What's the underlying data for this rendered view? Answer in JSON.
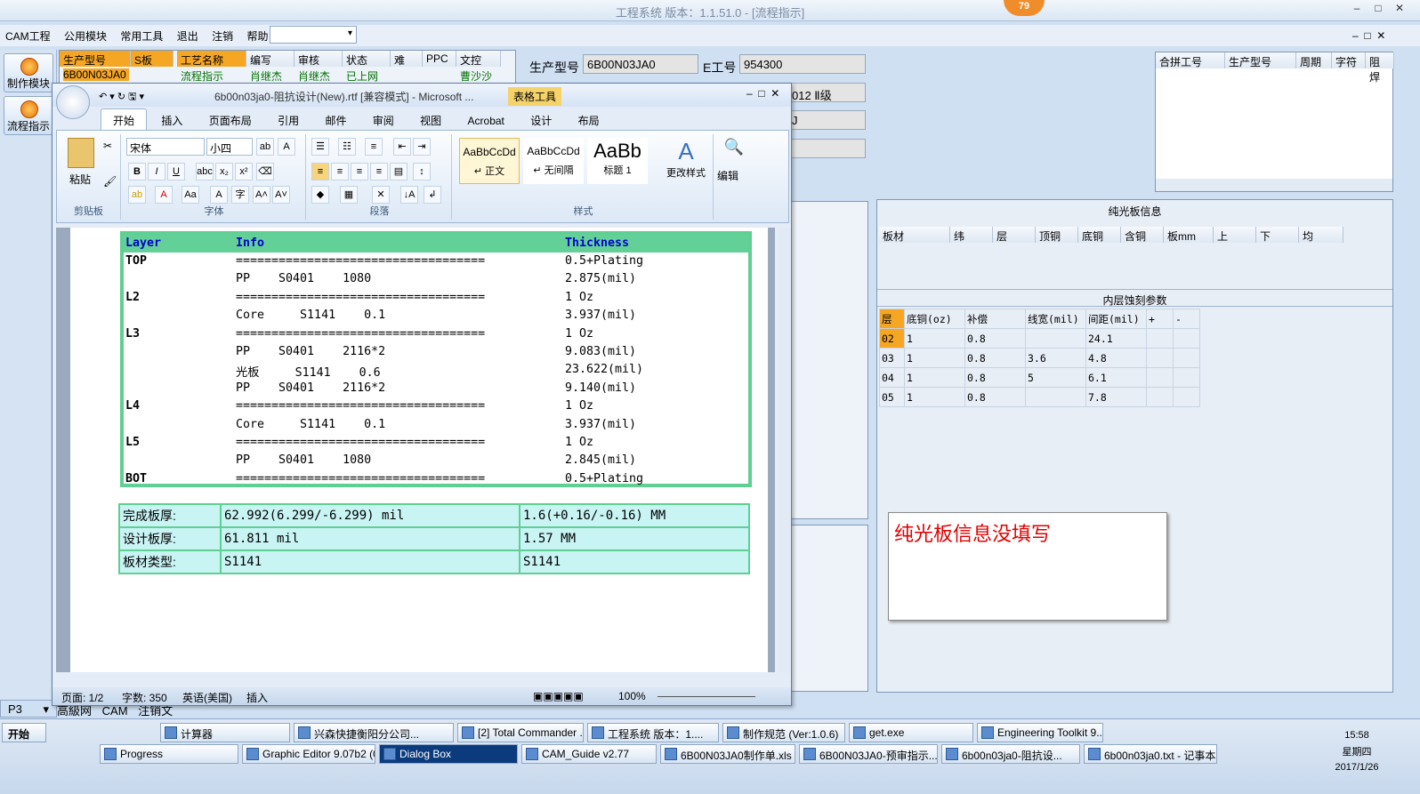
{
  "app": {
    "title": "工程系统  版本：1.1.51.0 - [流程指示]",
    "badge": "79"
  },
  "menu": [
    "CAM工程",
    "公用模块",
    "常用工具",
    "退出",
    "注销",
    "帮助"
  ],
  "left": {
    "btn1": "制作模块",
    "btn2": "流程指示",
    "page": "P3"
  },
  "topgrid": {
    "h1": "生产型号",
    "h2": "S板",
    "r1": "6B00N03JA0",
    "cols": [
      "工艺名称",
      "编写",
      "审核",
      "状态",
      "难",
      "PPC",
      "文控"
    ],
    "row": [
      "流程指示",
      "肖继杰",
      "肖继杰",
      "已上网",
      "",
      "",
      "曹沙沙"
    ]
  },
  "form": {
    "l1": "生产型号",
    "v1": "6B00N03JA0",
    "l2": "E工号",
    "v2": "954300",
    "v3": "012 Ⅱ级",
    "v4": "J"
  },
  "merge": {
    "cols": [
      "合拼工号",
      "生产型号",
      "周期",
      "字符",
      "阻焊"
    ]
  },
  "bottomtabs": [
    "高級网",
    "CAM",
    "注销文"
  ],
  "word": {
    "title": "6b00n03ja0-阻抗设计(New).rtf [兼容模式] - Microsoft ...",
    "tools": "表格工具",
    "tabs": [
      "开始",
      "插入",
      "页面布局",
      "引用",
      "邮件",
      "审阅",
      "视图",
      "Acrobat",
      "设计",
      "布局"
    ],
    "groups": [
      "剪贴板",
      "字体",
      "段落",
      "样式",
      "编辑"
    ],
    "paste": "粘贴",
    "font": "宋体",
    "size": "小四",
    "styles": [
      "AaBbCcDd",
      "AaBbCcDd",
      "AaBb"
    ],
    "stylenames": [
      "↵ 正文",
      "↵ 无间隔",
      "标题 1"
    ],
    "changestyle": "更改样式",
    "status": {
      "page": "页面: 1/2",
      "words": "字数: 350",
      "lang": "英语(美国)",
      "mode": "插入",
      "zoom": "100%"
    }
  },
  "layers": {
    "headers": [
      "Layer",
      "Info",
      "Thickness"
    ],
    "rows": [
      [
        "TOP",
        "===================================",
        "0.5+Plating"
      ],
      [
        "",
        "PP    S0401    1080",
        "2.875(mil)"
      ],
      [
        "L2",
        "===================================",
        "1 Oz"
      ],
      [
        "",
        "Core     S1141    0.1",
        "3.937(mil)"
      ],
      [
        "L3",
        "===================================",
        "1 Oz"
      ],
      [
        "",
        "PP    S0401    2116*2",
        "9.083(mil)"
      ],
      [
        "",
        "光板     S1141    0.6",
        "23.622(mil)"
      ],
      [
        "",
        "PP    S0401    2116*2",
        "9.140(mil)"
      ],
      [
        "L4",
        "===================================",
        "1 Oz"
      ],
      [
        "",
        "Core     S1141    0.1",
        "3.937(mil)"
      ],
      [
        "L5",
        "===================================",
        "1 Oz"
      ],
      [
        "",
        "PP    S0401    1080",
        "2.845(mil)"
      ],
      [
        "BOT",
        "===================================",
        "0.5+Plating"
      ]
    ]
  },
  "summary": [
    [
      "完成板厚:",
      "62.992(6.299/-6.299) mil",
      "1.6(+0.16/-0.16) MM"
    ],
    [
      "设计板厚:",
      "61.811 mil",
      "1.57 MM"
    ],
    [
      "板材类型:",
      "S1141",
      "S1141"
    ]
  ],
  "plain": {
    "title": "纯光板信息",
    "cols": [
      "板材",
      "纬",
      "层",
      "顶铜",
      "底铜",
      "含铜",
      "板mm",
      "上",
      "下",
      "均"
    ]
  },
  "etch": {
    "title": "内层蚀刻参数",
    "cols": [
      "层",
      "底铜(oz)",
      "补偿",
      "线宽(mil)",
      "间距(mil)",
      "+",
      "-"
    ],
    "rows": [
      [
        "02",
        "1",
        "0.8",
        "",
        "24.1"
      ],
      [
        "03",
        "1",
        "0.8",
        "3.6",
        "4.8"
      ],
      [
        "04",
        "1",
        "0.8",
        "5",
        "6.1"
      ],
      [
        "05",
        "1",
        "0.8",
        "",
        "7.8"
      ]
    ]
  },
  "note": "纯光板信息没填写",
  "taskbar": {
    "start": "开始",
    "time": "15:58",
    "day": "星期四",
    "date": "2017/1/26",
    "row1": [
      "计算器",
      "兴森快捷衡阳分公司...",
      "[2] Total Commander ...",
      "工程系统  版本：1....",
      "制作规范 (Ver:1.0.6)",
      "get.exe",
      "Engineering Toolkit 9...."
    ],
    "row2": [
      "Progress",
      "Graphic Editor 9.07b2 (0...",
      "Dialog Box",
      "CAM_Guide v2.77",
      "6B00N03JA0制作单.xls ...",
      "6B00N03JA0-预审指示....",
      "6b00n03ja0-阻抗设...",
      "6b00n03ja0.txt - 记事本"
    ]
  },
  "colors": {
    "accent": "#5fcf93",
    "cell": "#c9f4f4",
    "note": "#e00000"
  }
}
